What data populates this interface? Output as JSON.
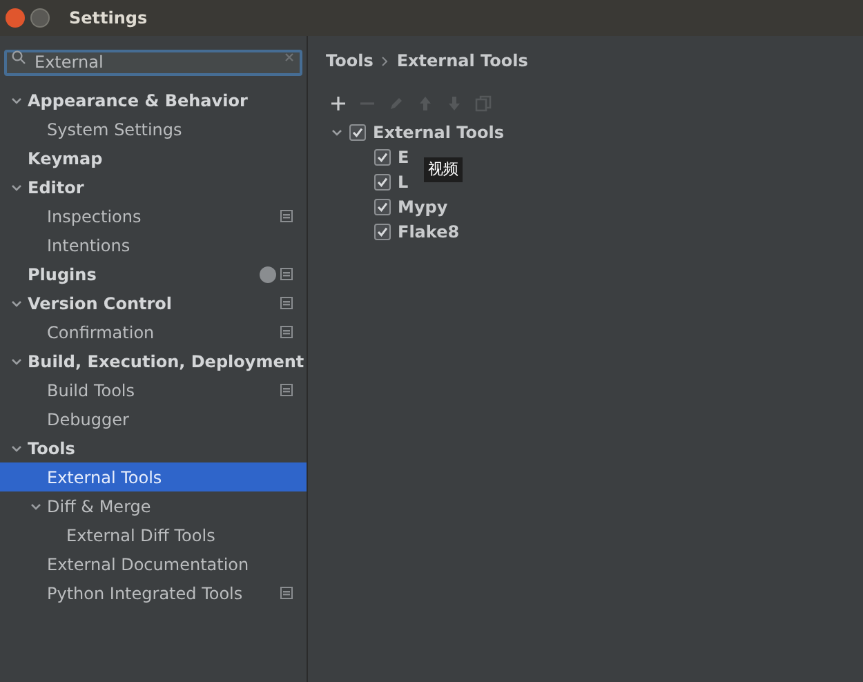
{
  "window": {
    "title": "Settings"
  },
  "search": {
    "value": "External"
  },
  "nav": [
    {
      "label": "Appearance & Behavior",
      "selected": false,
      "expanded": true,
      "scoped": false,
      "children": [
        {
          "label": "System Settings",
          "selected": false,
          "scoped": false
        }
      ]
    },
    {
      "label": "Keymap",
      "selected": false,
      "scoped": false
    },
    {
      "label": "Editor",
      "selected": false,
      "expanded": true,
      "scoped": false,
      "children": [
        {
          "label": "Inspections",
          "selected": false,
          "scoped": true
        },
        {
          "label": "Intentions",
          "selected": false,
          "scoped": false
        }
      ]
    },
    {
      "label": "Plugins",
      "selected": false,
      "scoped": true,
      "help": true
    },
    {
      "label": "Version Control",
      "selected": false,
      "expanded": true,
      "scoped": true,
      "children": [
        {
          "label": "Confirmation",
          "selected": false,
          "scoped": true
        }
      ]
    },
    {
      "label": "Build, Execution, Deployment",
      "selected": false,
      "expanded": true,
      "scoped": false,
      "children": [
        {
          "label": "Build Tools",
          "selected": false,
          "scoped": true
        },
        {
          "label": "Debugger",
          "selected": false,
          "scoped": false
        }
      ]
    },
    {
      "label": "Tools",
      "selected": false,
      "expanded": true,
      "scoped": false,
      "children": [
        {
          "label": "External Tools",
          "selected": true,
          "scoped": false
        },
        {
          "label": "Diff & Merge",
          "selected": false,
          "expanded": true,
          "scoped": false,
          "children": [
            {
              "label": "External Diff Tools",
              "selected": false,
              "scoped": false
            }
          ]
        },
        {
          "label": "External Documentation",
          "selected": false,
          "scoped": false
        },
        {
          "label": "Python Integrated Tools",
          "selected": false,
          "scoped": true
        }
      ]
    }
  ],
  "breadcrumb": [
    "Tools",
    "External Tools"
  ],
  "toolbar": [
    {
      "kind": "add",
      "disabled": false
    },
    {
      "kind": "remove",
      "disabled": true
    },
    {
      "kind": "edit",
      "disabled": true
    },
    {
      "kind": "up",
      "disabled": true
    },
    {
      "kind": "down",
      "disabled": true
    },
    {
      "kind": "copy",
      "disabled": true
    }
  ],
  "tools_tree": {
    "label": "External Tools",
    "checked": true,
    "expanded": true,
    "children": [
      {
        "label": "E",
        "checked": true
      },
      {
        "label": "L",
        "checked": true
      },
      {
        "label": "Mypy",
        "checked": true
      },
      {
        "label": "Flake8",
        "checked": true
      }
    ]
  },
  "tooltip": "视频"
}
